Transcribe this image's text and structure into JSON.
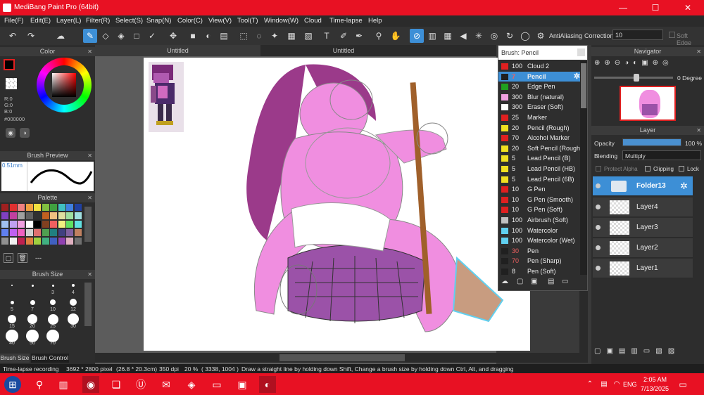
{
  "window": {
    "title": "MediBang Paint Pro (64bit)",
    "minimize": "—",
    "maximize": "☐",
    "close": "✕"
  },
  "menu": [
    "File(F)",
    "Edit(E)",
    "Layer(L)",
    "Filter(R)",
    "Select(S)",
    "Snap(N)",
    "Color(C)",
    "View(V)",
    "Tool(T)",
    "Window(W)",
    "Cloud",
    "Time-lapse",
    "Help"
  ],
  "toolbar": {
    "antialiasing_label": "AntiAliasing",
    "correction_label": "Correction",
    "correction_value": "10",
    "soft_edge_label": "Soft Edge"
  },
  "color_panel": {
    "title": "Color",
    "r": "R:0",
    "g": "G:0",
    "b": "B:0",
    "hex": "#000000"
  },
  "brush_preview": {
    "title": "Brush Preview",
    "size": "0.51mm"
  },
  "palette": {
    "title": "Palette",
    "colors": [
      "#a02020",
      "#e03030",
      "#f08080",
      "#f0a040",
      "#f0e040",
      "#80c040",
      "#40a040",
      "#40c0c0",
      "#4080e0",
      "#2040a0",
      "#8040c0",
      "#c040a0",
      "#a0a0a0",
      "#606060",
      "#303030",
      "#c06020",
      "#f0c080",
      "#e0e0a0",
      "#a0e0a0",
      "#a0e0e0",
      "#a0c0f0",
      "#c0a0f0",
      "#f0a0e0",
      "#ffffff",
      "#000000",
      "#804020",
      "#f06060",
      "#f0f080",
      "#60e060",
      "#60e0e0",
      "#6080f0",
      "#c060f0",
      "#f060c0",
      "#d0d0d0",
      "#e07070",
      "#50a050",
      "#208080",
      "#404080",
      "#8060a0",
      "#c08060",
      "#909090",
      "#f0f0f0",
      "#c02050",
      "#e08040",
      "#a0d040",
      "#40b080",
      "#4060c0",
      "#9040b0",
      "#e0b0c0",
      "#707070"
    ],
    "add_label": "---"
  },
  "brush_size": {
    "title": "Brush Size",
    "sizes": [
      "3",
      "4",
      "5",
      "7",
      "10",
      "12",
      "15",
      "20",
      "25",
      "30",
      "40",
      "50",
      "70"
    ]
  },
  "brush_size_tabs": [
    "Brush Size",
    "Brush Control"
  ],
  "doc_tabs": [
    "Untitled",
    "Untitled"
  ],
  "brush_panel": {
    "title": "Brush: Pencil",
    "items": [
      {
        "color": "#e02020",
        "size": "100",
        "name": "Cloud 2"
      },
      {
        "color": "#202020",
        "size": "7",
        "name": "Pencil",
        "selected": true
      },
      {
        "color": "#20a020",
        "size": "20",
        "name": "Edge Pen"
      },
      {
        "color": "#f0a0e0",
        "size": "300",
        "name": "Blur (natural)"
      },
      {
        "color": "#ffffff",
        "size": "300",
        "name": "Eraser (Soft)"
      },
      {
        "color": "#e02020",
        "size": "25",
        "name": "Marker"
      },
      {
        "color": "#f0e020",
        "size": "20",
        "name": "Pencil (Rough)"
      },
      {
        "color": "#e02020",
        "size": "70",
        "name": "Alcohol Marker"
      },
      {
        "color": "#f0e020",
        "size": "20",
        "name": "Soft Pencil (Rough)"
      },
      {
        "color": "#f0e020",
        "size": "5",
        "name": "Lead Pencil (B)"
      },
      {
        "color": "#f0e020",
        "size": "5",
        "name": "Lead Pencil (HB)"
      },
      {
        "color": "#f0e020",
        "size": "5",
        "name": "Lead Pencil (6B)"
      },
      {
        "color": "#e02020",
        "size": "10",
        "name": "G Pen"
      },
      {
        "color": "#e02020",
        "size": "10",
        "name": "G Pen (Smooth)"
      },
      {
        "color": "#e02020",
        "size": "10",
        "name": "G Pen (Soft)"
      },
      {
        "color": "#c0c0c0",
        "size": "100",
        "name": "Airbrush (Soft)"
      },
      {
        "color": "#60d0f0",
        "size": "100",
        "name": "Watercolor"
      },
      {
        "color": "#60d0f0",
        "size": "100",
        "name": "Watercolor (Wet)"
      },
      {
        "color": "#202020",
        "size": "30",
        "name": "Pen"
      },
      {
        "color": "#202020",
        "size": "70",
        "name": "Pen (Sharp)"
      },
      {
        "color": "#202020",
        "size": "8",
        "name": "Pen (Soft)"
      }
    ]
  },
  "navigator": {
    "title": "Navigator",
    "angle": "0 Degree"
  },
  "layer_panel": {
    "title": "Layer",
    "opacity_label": "Opacity",
    "opacity_value": "100 %",
    "blending_label": "Blending",
    "blending_value": "Multiply",
    "protect_alpha": "Protect Alpha",
    "clipping": "Clipping",
    "lock": "Lock",
    "layers": [
      "Folder13",
      "Layer4",
      "Layer3",
      "Layer2",
      "Layer1"
    ]
  },
  "status": {
    "recording": "Time-lapse recording",
    "pixel": "3692 * 2800 pixel",
    "cm": "(26.8 * 20.3cm)",
    "dpi": "350 dpi",
    "zoom": "20 %",
    "coords": "( 3338, 1004 )",
    "hint": "Draw a straight line by holding down Shift, Change a brush size by holding down Ctrl, Alt, and dragging"
  },
  "taskbar": {
    "time": "2:05 AM",
    "date": "7/13/2025",
    "lang": "ENG"
  }
}
